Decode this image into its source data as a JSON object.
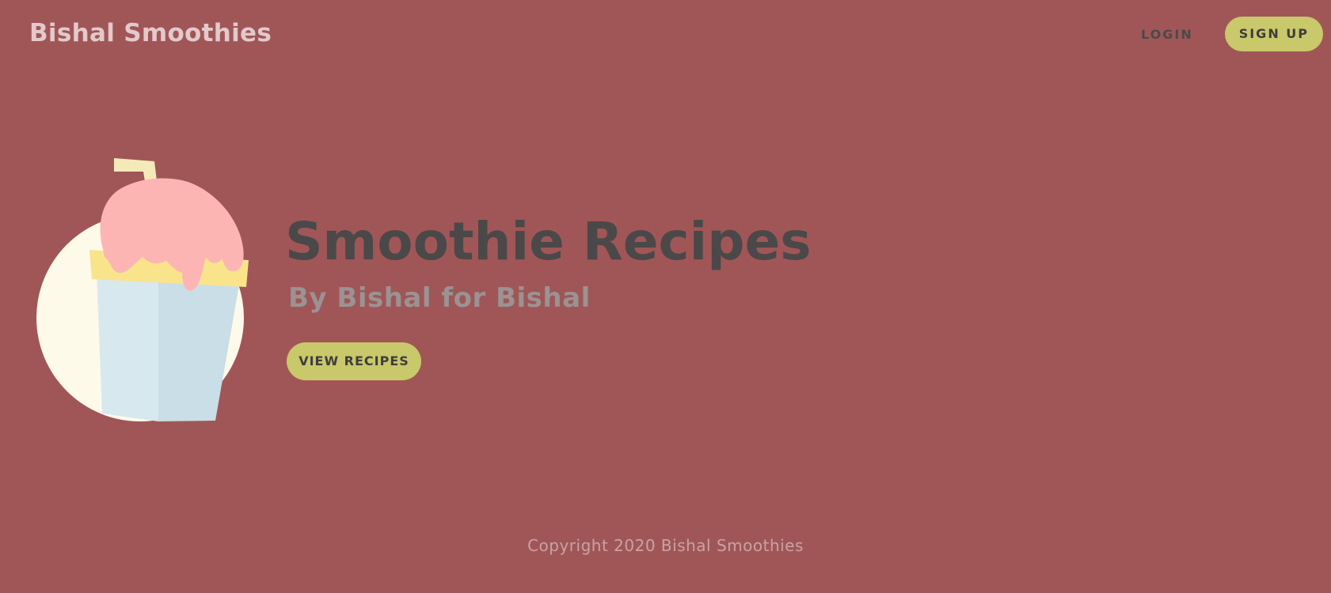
{
  "header": {
    "brand": "Bishal Smoothies",
    "login_label": "LOGIN",
    "signup_label": "SIGN UP"
  },
  "hero": {
    "illustration": "smoothie-cup-icon",
    "title": "Smoothie Recipes",
    "subtitle": "By Bishal for Bishal",
    "button_label": "VIEW RECIPES"
  },
  "footer": {
    "copyright": "Copyright 2020 Bishal Smoothies"
  },
  "colors": {
    "background": "#a05657",
    "accent_button": "#c9c86a",
    "brand_text": "#e3c9cb",
    "title_text": "#4b4849",
    "subtitle_text": "#9b9293",
    "footer_text": "#c9a2a3"
  }
}
